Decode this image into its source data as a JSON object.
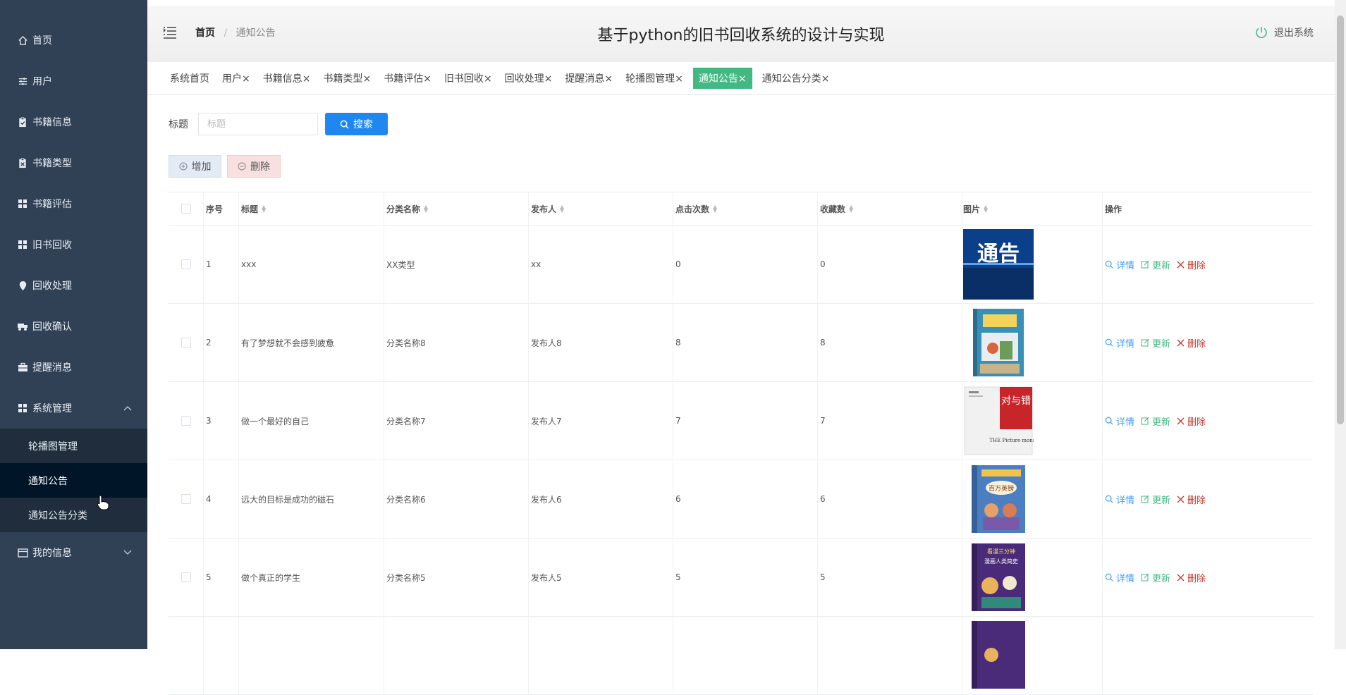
{
  "sidebar": {
    "items": [
      {
        "label": "首页",
        "icon": "home-icon"
      },
      {
        "label": "用户",
        "icon": "sliders-icon"
      },
      {
        "label": "书籍信息",
        "icon": "clipboard-icon"
      },
      {
        "label": "书籍类型",
        "icon": "clipboard-icon"
      },
      {
        "label": "书籍评估",
        "icon": "grid-icon"
      },
      {
        "label": "旧书回收",
        "icon": "grid-icon"
      },
      {
        "label": "回收处理",
        "icon": "location-icon"
      },
      {
        "label": "回收确认",
        "icon": "tractor-icon"
      },
      {
        "label": "提醒消息",
        "icon": "briefcase-icon"
      },
      {
        "label": "系统管理",
        "icon": "grid-icon"
      }
    ],
    "submenu": [
      {
        "label": "轮播图管理"
      },
      {
        "label": "通知公告"
      },
      {
        "label": "通知公告分类"
      }
    ],
    "my_info": "我的信息"
  },
  "header": {
    "title": "基于python的旧书回收系统的设计与实现",
    "breadcrumb_home": "首页",
    "breadcrumb_sep": "/",
    "breadcrumb_current": "通知公告",
    "logout": "退出系统"
  },
  "tabs": [
    {
      "label": "系统首页"
    },
    {
      "label": "用户"
    },
    {
      "label": "书籍信息"
    },
    {
      "label": "书籍类型"
    },
    {
      "label": "书籍评估"
    },
    {
      "label": "旧书回收"
    },
    {
      "label": "回收处理"
    },
    {
      "label": "提醒消息"
    },
    {
      "label": "轮播图管理"
    },
    {
      "label": "通知公告",
      "active": true
    },
    {
      "label": "通知公告分类"
    }
  ],
  "tab_close": "×",
  "search": {
    "label": "标题",
    "placeholder": "标题",
    "button": "搜索"
  },
  "actions": {
    "add": "增加",
    "delete": "删除"
  },
  "table": {
    "columns": [
      "序号",
      "标题",
      "分类名称",
      "发布人",
      "点击次数",
      "收藏数",
      "图片",
      "操作"
    ],
    "rows": [
      {
        "idx": "1",
        "title": "xxx",
        "category": "XX类型",
        "publisher": "xx",
        "clicks": "0",
        "favorites": "0",
        "image": "notice-banner"
      },
      {
        "idx": "2",
        "title": "有了梦想就不会感到疲惫",
        "category": "分类名称8",
        "publisher": "发布人8",
        "clicks": "8",
        "favorites": "8",
        "image": "book-cover"
      },
      {
        "idx": "3",
        "title": "做一个最好的自己",
        "category": "分类名称7",
        "publisher": "发布人7",
        "clicks": "7",
        "favorites": "7",
        "image": "book-cover"
      },
      {
        "idx": "4",
        "title": "远大的目标是成功的磁石",
        "category": "分类名称6",
        "publisher": "发布人6",
        "clicks": "6",
        "favorites": "6",
        "image": "book-cover"
      },
      {
        "idx": "5",
        "title": "做个真正的学生",
        "category": "分类名称5",
        "publisher": "发布人5",
        "clicks": "5",
        "favorites": "5",
        "image": "book-cover"
      }
    ],
    "ops": {
      "detail": "详情",
      "update": "更新",
      "delete": "删除"
    }
  },
  "images": {
    "notice_text": "通告",
    "cover3_red": "对与错",
    "cover3_en": "THE Picture monster",
    "cover4_title": "百万英镑",
    "cover5_title": "漫画人类简史",
    "cover5_top": "看漫三分钟"
  },
  "colors": {
    "sidebar_bg": "#304156",
    "active_tab": "#42b983",
    "search_btn": "#1e88f0"
  }
}
